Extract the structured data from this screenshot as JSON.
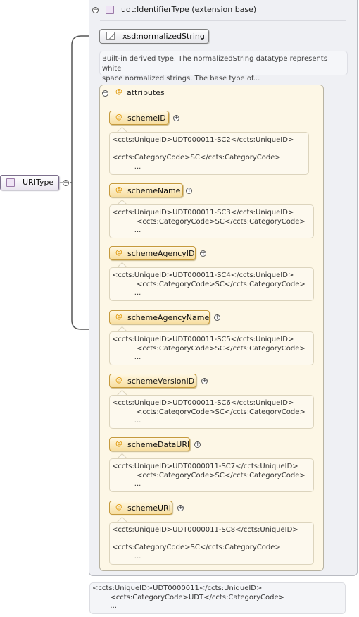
{
  "extension": {
    "title": "udt:IdentifierType (extension base)",
    "collapse_symbol": "⊖"
  },
  "base_type": {
    "label": "xsd:normalizedString",
    "description_line1": "Built-in derived type. The normalizedString datatype represents white",
    "description_line2": "space normalized strings. The base type of..."
  },
  "attributes": {
    "title": "attributes",
    "items": [
      {
        "name": "schemeID",
        "doc": "<ccts:UniqueID>UDT000011-SC2</ccts:UniqueID>\n\n<ccts:CategoryCode>SC</ccts:CategoryCode>\n          ..."
      },
      {
        "name": "schemeName",
        "doc": "<ccts:UniqueID>UDT000011-SC3</ccts:UniqueID>\n           <ccts:CategoryCode>SC</ccts:CategoryCode>\n          ..."
      },
      {
        "name": "schemeAgencyID",
        "doc": "<ccts:UniqueID>UDT000011-SC4</ccts:UniqueID>\n           <ccts:CategoryCode>SC</ccts:CategoryCode>\n          ..."
      },
      {
        "name": "schemeAgencyName",
        "doc": "<ccts:UniqueID>UDT000011-SC5</ccts:UniqueID>\n           <ccts:CategoryCode>SC</ccts:CategoryCode>\n          ..."
      },
      {
        "name": "schemeVersionID",
        "doc": "<ccts:UniqueID>UDT000011-SC6</ccts:UniqueID>\n           <ccts:CategoryCode>SC</ccts:CategoryCode>\n          ..."
      },
      {
        "name": "schemeDataURI",
        "doc": "<ccts:UniqueID>UDT0000011-SC7</ccts:UniqueID>\n           <ccts:CategoryCode>SC</ccts:CategoryCode>\n          ..."
      },
      {
        "name": "schemeURI",
        "doc": "<ccts:UniqueID>UDT0000011-SC8</ccts:UniqueID>\n\n<ccts:CategoryCode>SC</ccts:CategoryCode>\n          ..."
      }
    ]
  },
  "type_doc": "<ccts:UniqueID>UDT0000011</ccts:UniqueID>\n        <ccts:CategoryCode>UDT</ccts:CategoryCode>\n        ...",
  "node": {
    "label": "URIType"
  },
  "icons": {
    "collapse": "minus-circle-icon",
    "expand": "plus-circle-icon",
    "complex_type": "complex-type-icon",
    "simple_type": "simple-type-icon",
    "attribute": "attribute-at-icon"
  },
  "colors": {
    "attribute_accent": "#e09b10",
    "attribute_fill": "#f7dea0",
    "extension_bg": "#eff0f4",
    "attr_bg": "#fdf7e6"
  }
}
